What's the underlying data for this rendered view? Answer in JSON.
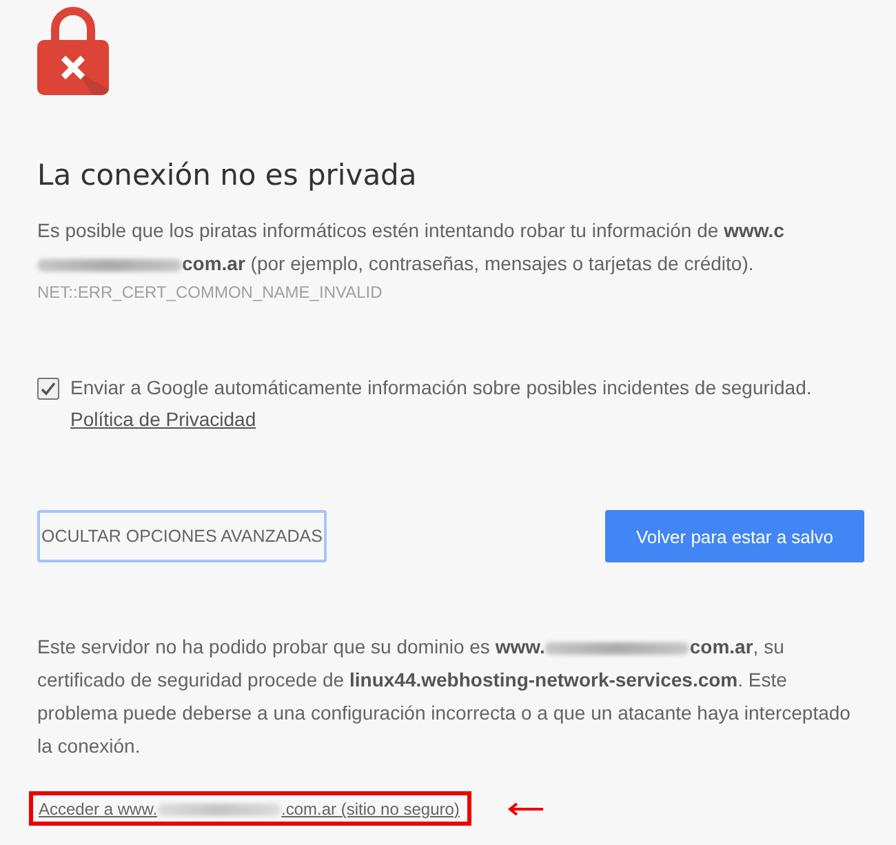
{
  "heading": "La conexión no es privada",
  "intro": [
    {
      "kind": "text",
      "text": "Es posible que los piratas informáticos estén intentando robar tu información de "
    },
    {
      "kind": "text",
      "text": "www.c",
      "bold": true
    },
    {
      "kind": "redacted"
    },
    {
      "kind": "text",
      "text": "com.ar",
      "bold": true
    },
    {
      "kind": "text",
      "text": " (por ejemplo, contraseñas, mensajes o tarjetas de crédito)."
    }
  ],
  "error_code": "NET::ERR_CERT_COMMON_NAME_INVALID",
  "report": {
    "checked": true,
    "text": "Enviar a Google automáticamente información sobre posibles incidentes de seguridad. ",
    "link": "Política de Privacidad"
  },
  "buttons": [
    {
      "kind": "secondary",
      "label": "OCULTAR OPCIONES AVANZADAS",
      "focused": true
    },
    {
      "kind": "primary",
      "label": "Volver para estar a salvo"
    }
  ],
  "details": [
    {
      "kind": "text",
      "text": "Este servidor no ha podido probar que su dominio es "
    },
    {
      "kind": "text",
      "text": "www.",
      "bold": true
    },
    {
      "kind": "redacted"
    },
    {
      "kind": "text",
      "text": "com.ar",
      "bold": true
    },
    {
      "kind": "text",
      "text": ", su certificado de seguridad procede de "
    },
    {
      "kind": "text",
      "text": "linux44.webhosting-network-services.com",
      "bold": true
    },
    {
      "kind": "text",
      "text": ". Este problema puede deberse a una configuración incorrecta o a que un atacante haya interceptado la conexión."
    }
  ],
  "proceed_link": {
    "highlighted": true,
    "parts": [
      {
        "kind": "text",
        "text": "Acceder a www."
      },
      {
        "kind": "redacted"
      },
      {
        "kind": "text",
        "text": ".com.ar (sitio no seguro)"
      }
    ]
  }
}
